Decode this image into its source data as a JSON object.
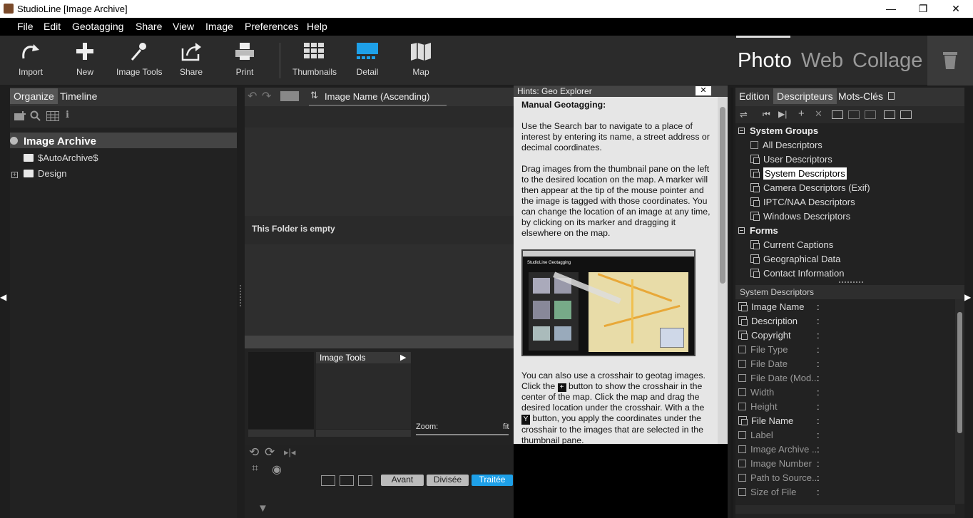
{
  "window": {
    "title": "StudioLine [Image Archive]",
    "minimize": "—",
    "restore": "❐",
    "close": "✕"
  },
  "menu": [
    "File",
    "Edit",
    "Geotagging",
    "Share",
    "View",
    "Image",
    "Preferences",
    "Help"
  ],
  "toolbar": {
    "import": "Import",
    "new": "New",
    "image_tools": "Image Tools",
    "share": "Share",
    "print": "Print",
    "thumbnails": "Thumbnails",
    "detail": "Detail",
    "map": "Map"
  },
  "modes": {
    "photo": "Photo",
    "web": "Web",
    "collage": "Collage"
  },
  "left": {
    "tabs": [
      "Organize",
      "Timeline"
    ],
    "tree": {
      "root": "Image Archive",
      "child1": "$AutoArchive$",
      "child2": "Design"
    }
  },
  "center": {
    "sort_label": "Image Name (Ascending)",
    "empty_message": "This Folder is empty",
    "image_tools_label": "Image Tools",
    "zoom_label": "Zoom:",
    "zoom_fit": "fit",
    "buttons": {
      "avant": "Avant",
      "divisee": "Divisée",
      "traitee": "Traitée"
    }
  },
  "hints": {
    "title": "Hints: Geo Explorer",
    "close": "✕",
    "heading": "Manual Geotagging:",
    "p1": "Use the Search bar to navigate to a place of interest by entering its name, a street address or decimal coordinates.",
    "p2": "Drag images from the thumbnail pane on the left to the desired location on the map. A marker will then appear at the tip of the mouse pointer and the image is tagged with those coordinates. You can change the location of an image at any time, by clicking on its marker and dragging it elsewhere on the map.",
    "p3a": "You can also use a crosshair to geotag images. Click the",
    "p3b": "button to show the crosshair in the center of the map. Click the map and drag the desired location under the crosshair. With a",
    "p3c": "the",
    "p3d": "button, you apply the coordinates under the crosshair to the images that are selected in the thumbnail pane.",
    "screenshot_title": "StudioLine Geotagging"
  },
  "right": {
    "tabs": [
      "Edition",
      "Descripteurs",
      "Mots-Clés"
    ],
    "groups": {
      "system": "System Groups",
      "forms": "Forms"
    },
    "system_items": [
      "All Descriptors",
      "User Descriptors",
      "System Descriptors",
      "Camera Descriptors (Exif)",
      "IPTC/NAA Descriptors",
      "Windows Descriptors"
    ],
    "form_items": [
      "Current Captions",
      "Geographical Data",
      "Contact Information"
    ],
    "section_title": "System Descriptors",
    "descriptors": [
      {
        "name": "Image Name",
        "v": ":"
      },
      {
        "name": "Description",
        "v": ":"
      },
      {
        "name": "Copyright",
        "v": ":"
      },
      {
        "name": "File Type",
        "v": ":"
      },
      {
        "name": "File Date",
        "v": ":"
      },
      {
        "name": "File Date (Mod...",
        "v": ":"
      },
      {
        "name": "Width",
        "v": ":"
      },
      {
        "name": "Height",
        "v": ":"
      },
      {
        "name": "File Name",
        "v": ":"
      },
      {
        "name": "Label",
        "v": ":"
      },
      {
        "name": "Image Archive ...",
        "v": ":"
      },
      {
        "name": "Image Number",
        "v": ":"
      },
      {
        "name": "Path to Source...",
        "v": ":"
      },
      {
        "name": "Size of File",
        "v": ":"
      }
    ]
  },
  "colors": {
    "accent": "#1ea0e8",
    "selected_tab": "#555555",
    "hint_bg": "#e6e6e6"
  }
}
